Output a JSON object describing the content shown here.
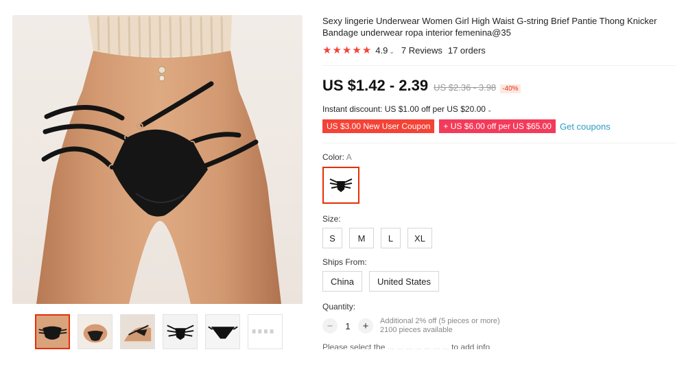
{
  "product": {
    "title": "Sexy lingerie Underwear Women Girl High Waist G-string Brief Pantie Thong Knicker Bandage underwear ropa interior femenina@35",
    "rating": "4.9",
    "reviews": "7 Reviews",
    "orders": "17 orders",
    "price": "US $1.42 - 2.39",
    "original_price": "US $2.36 - 3.98",
    "discount": "-40%",
    "instant_discount": "Instant discount: US $1.00 off per US $20.00",
    "coupon_new_user": "US $3.00 New User Coupon",
    "coupon_off": "+ US $6.00 off per US $65.00",
    "get_coupons": "Get coupons"
  },
  "color": {
    "label": "Color:",
    "value": "A"
  },
  "size": {
    "label": "Size:",
    "options": [
      "S",
      "M",
      "L",
      "XL"
    ]
  },
  "ships": {
    "label": "Ships From:",
    "options": [
      "China",
      "United States"
    ]
  },
  "quantity": {
    "label": "Quantity:",
    "value": "1",
    "minus": "−",
    "plus": "+",
    "additional": "Additional 2% off (5 pieces or more)",
    "available": "2100 pieces available"
  },
  "footer_clip": "Please select the ... ... ... ... ... ... ... to add info",
  "icons": [
    "star-icon",
    "chevron-down-icon",
    "minus-icon",
    "plus-icon"
  ],
  "colors": {
    "accent": "#e62e04",
    "star": "#f44336",
    "link": "#2e9cc3",
    "coupon": "#f44336",
    "coupon2": "#f43a5a"
  }
}
